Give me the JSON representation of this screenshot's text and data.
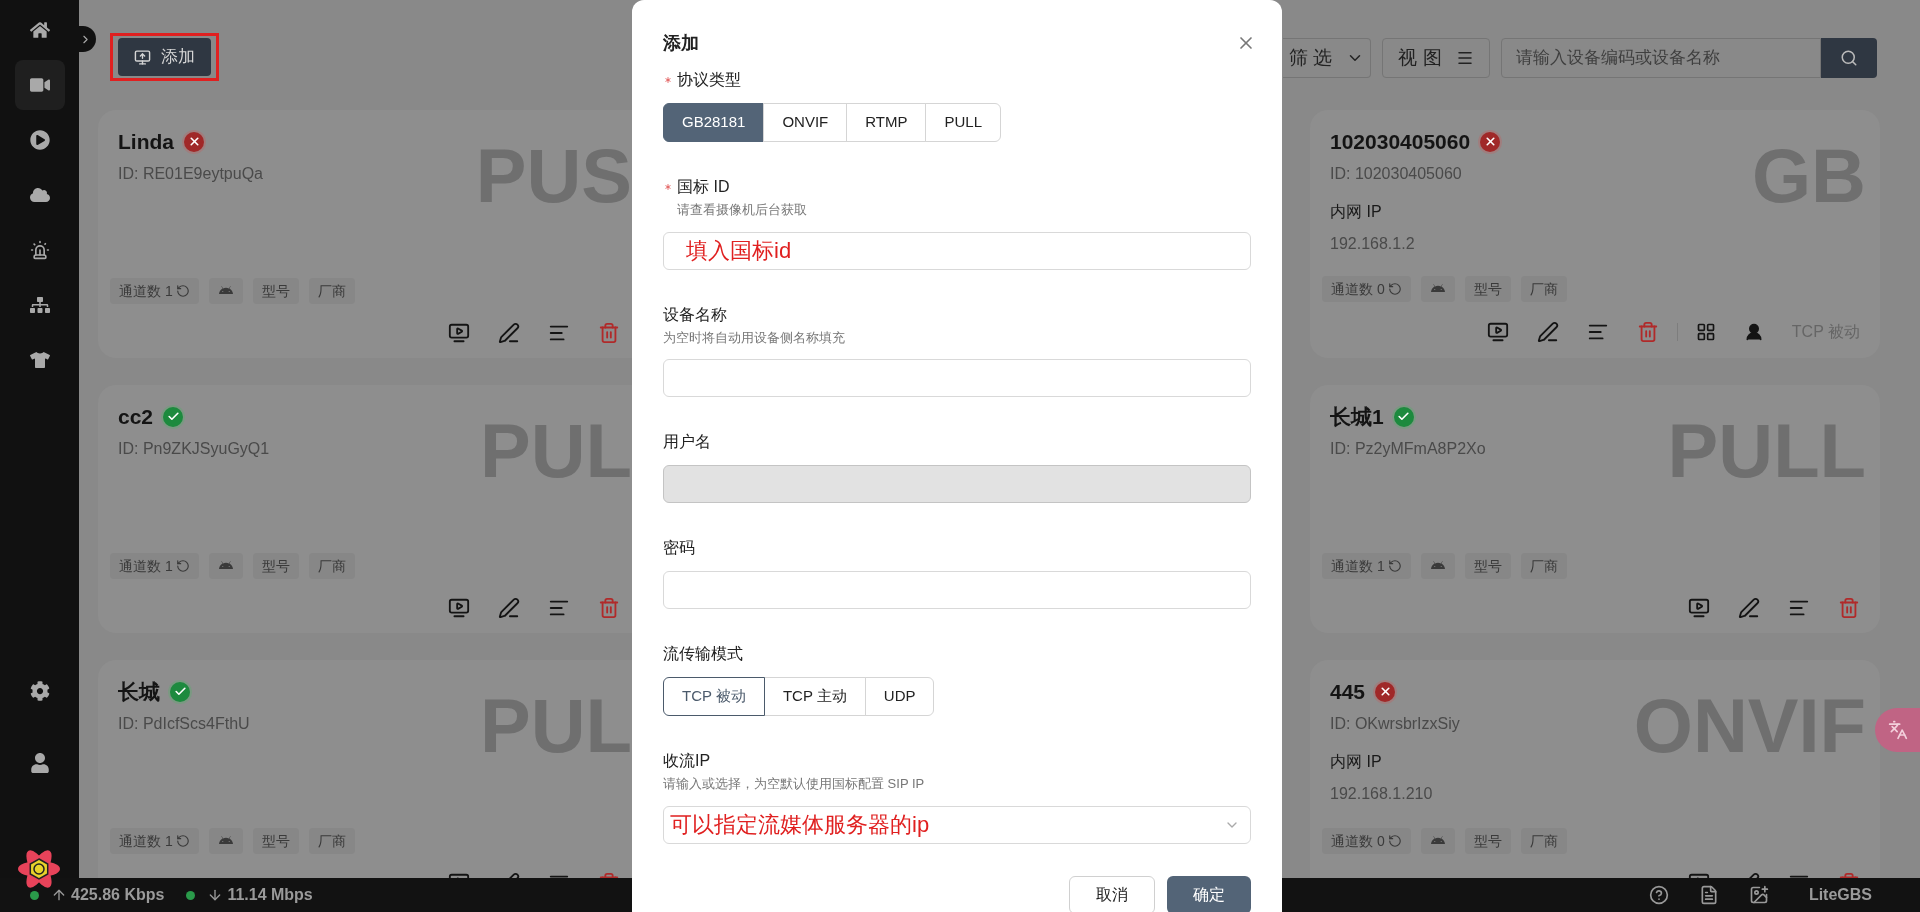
{
  "sidebar": {
    "items": [
      {
        "kind": "home",
        "selected": false
      },
      {
        "kind": "camera",
        "selected": true
      },
      {
        "kind": "play",
        "selected": false
      },
      {
        "kind": "cloud",
        "selected": false
      },
      {
        "kind": "alarm",
        "selected": false
      },
      {
        "kind": "network",
        "selected": false
      },
      {
        "kind": "shirt",
        "selected": false
      }
    ],
    "bottom_items": [
      {
        "kind": "settings",
        "selected": false
      },
      {
        "kind": "user",
        "selected": false
      }
    ]
  },
  "toolbar": {
    "add_button": "添加",
    "filter_button": "筛 选",
    "view_button": "视 图",
    "search": {
      "placeholder": "请输入设备编码或设备名称"
    }
  },
  "left_cards": [
    {
      "name": "Linda",
      "online": false,
      "id": "ID: RE01E9eytpuQa",
      "watermark": "PUS",
      "tags": {
        "channels": "通道数 1",
        "model": "型号",
        "vendor": "厂商"
      }
    },
    {
      "name": "cc2",
      "online": true,
      "id": "ID: Pn9ZKJSyuGyQ1",
      "watermark": "PUL",
      "tags": {
        "channels": "通道数 1",
        "model": "型号",
        "vendor": "厂商"
      }
    },
    {
      "name": "长城",
      "online": true,
      "id": "ID: PdIcfScs4FthU",
      "watermark": "PUL",
      "tags": {
        "channels": "通道数 1",
        "model": "型号",
        "vendor": "厂商"
      }
    }
  ],
  "right_cards": [
    {
      "name": "102030405060",
      "online": false,
      "id": "ID: 102030405060",
      "watermark": "GB",
      "lan_ip_label": "内网 IP",
      "lan_ip": "192.168.1.2",
      "tags": {
        "channels": "通道数 0",
        "model": "型号",
        "vendor": "厂商"
      },
      "transport": "TCP 被动"
    },
    {
      "name": "长城1",
      "online": true,
      "id": "ID: Pz2yMFmA8P2Xo",
      "watermark": "PULL",
      "tags": {
        "channels": "通道数 1",
        "model": "型号",
        "vendor": "厂商"
      }
    },
    {
      "name": "445",
      "online": false,
      "id": "ID: OKwrsbrIzxSiy",
      "watermark": "ONVIF",
      "lan_ip_label": "内网 IP",
      "lan_ip": "192.168.1.210",
      "tags": {
        "channels": "通道数 0",
        "model": "型号",
        "vendor": "厂商"
      }
    }
  ],
  "status_bar": {
    "upload": "425.86 Kbps",
    "download": "11.14 Mbps",
    "brand": "LiteGBS"
  },
  "dialog": {
    "title": "添加",
    "fields": [
      {
        "kind": "segmented",
        "label": "协议类型",
        "required": true,
        "options": [
          {
            "label": "GB28181",
            "selected": true
          },
          {
            "label": "ONVIF",
            "selected": false
          },
          {
            "label": "RTMP",
            "selected": false
          },
          {
            "label": "PULL",
            "selected": false
          }
        ]
      },
      {
        "kind": "input",
        "label": "国标 ID",
        "required": true,
        "hint": "请查看摄像机后台获取",
        "value": "填入国标id",
        "disabled": false
      },
      {
        "kind": "input",
        "label": "设备名称",
        "required": false,
        "hint": "为空时将自动用设备侧名称填充",
        "disabled": false
      },
      {
        "kind": "input",
        "label": "用户名",
        "required": false,
        "disabled": true
      },
      {
        "kind": "input",
        "label": "密码",
        "required": false,
        "disabled": false
      },
      {
        "kind": "button_group",
        "label": "流传输模式",
        "required": false,
        "options": [
          {
            "label": "TCP 被动",
            "selected": true
          },
          {
            "label": "TCP 主动",
            "selected": false
          },
          {
            "label": "UDP",
            "selected": false
          }
        ]
      },
      {
        "kind": "select",
        "label": "收流IP",
        "required": false,
        "hint": "请输入或选择，为空默认使用国标配置 SIP IP",
        "value": "可以指定流媒体服务器的ip"
      }
    ],
    "buttons": [
      {
        "label": "取消",
        "kind": "secondary"
      },
      {
        "label": "确定",
        "kind": "primary"
      }
    ]
  }
}
